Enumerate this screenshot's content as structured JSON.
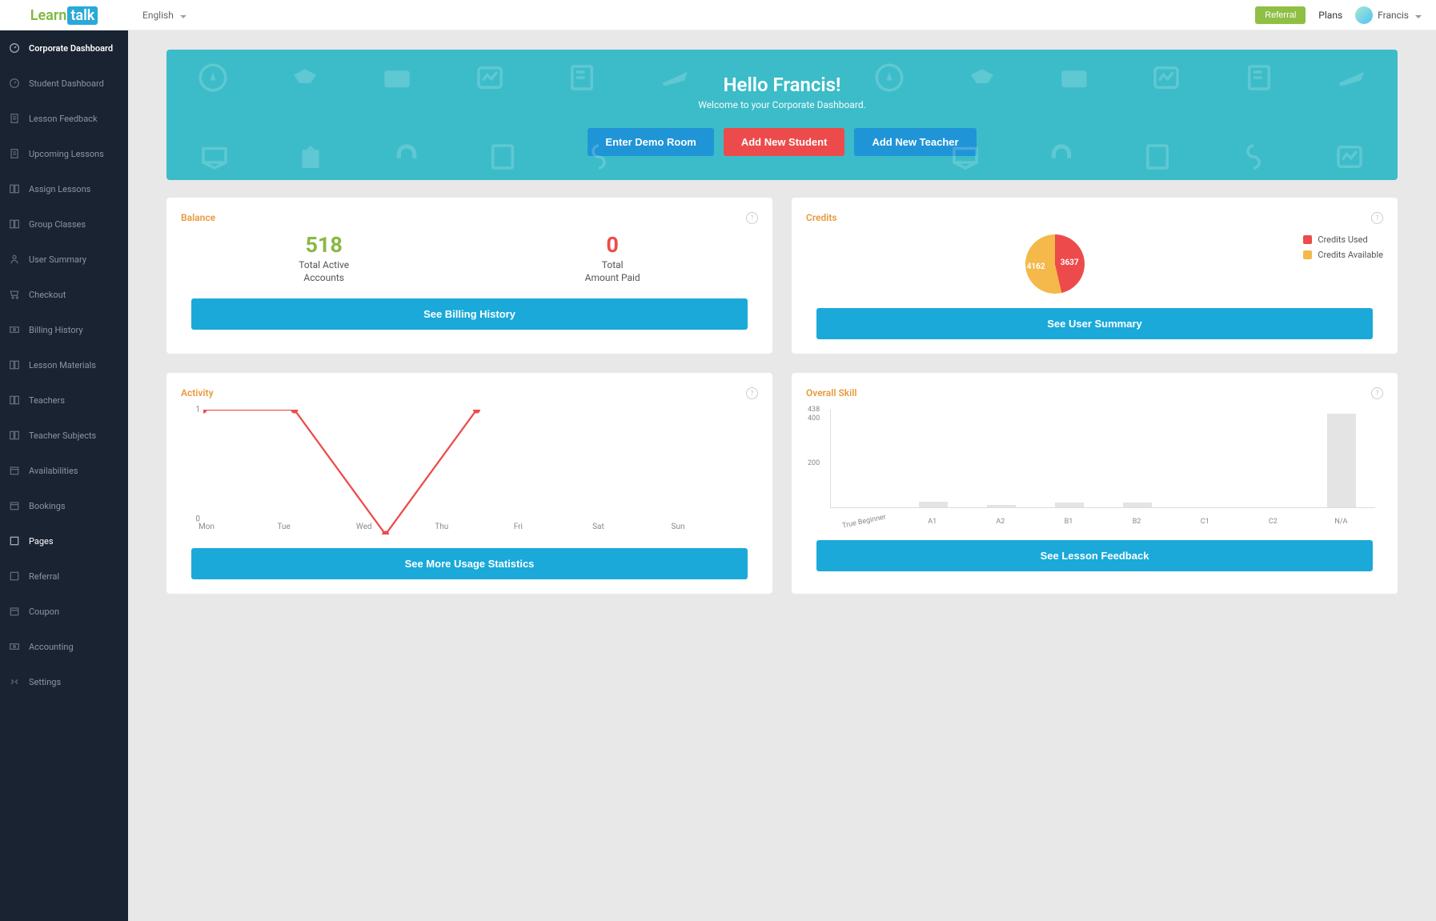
{
  "brand": {
    "learn": "Learn",
    "talk": "talk"
  },
  "topbar": {
    "lang": "English",
    "referral": "Referral",
    "plans": "Plans",
    "user": "Francis"
  },
  "sidebar": {
    "items": [
      {
        "label": "Corporate Dashboard",
        "icon": "dashboard-icon",
        "active": true
      },
      {
        "label": "Student Dashboard",
        "icon": "dashboard-icon"
      },
      {
        "label": "Lesson Feedback",
        "icon": "document-icon"
      },
      {
        "label": "Upcoming Lessons",
        "icon": "document-icon"
      },
      {
        "label": "Assign Lessons",
        "icon": "book-icon"
      },
      {
        "label": "Group Classes",
        "icon": "book-icon"
      },
      {
        "label": "User Summary",
        "icon": "user-icon"
      },
      {
        "label": "Checkout",
        "icon": "cart-icon"
      },
      {
        "label": "Billing History",
        "icon": "money-icon"
      },
      {
        "label": "Lesson Materials",
        "icon": "book-icon"
      },
      {
        "label": "Teachers",
        "icon": "book-icon"
      },
      {
        "label": "Teacher Subjects",
        "icon": "book-icon"
      },
      {
        "label": "Availabilities",
        "icon": "calendar-icon"
      },
      {
        "label": "Bookings",
        "icon": "calendar-icon"
      },
      {
        "label": "Pages",
        "icon": "page-icon",
        "active2": true
      },
      {
        "label": "Referral",
        "icon": "page-icon"
      },
      {
        "label": "Coupon",
        "icon": "calendar-icon"
      },
      {
        "label": "Accounting",
        "icon": "money-icon"
      },
      {
        "label": "Settings",
        "icon": "settings-icon"
      }
    ]
  },
  "hero": {
    "title": "Hello Francis!",
    "subtitle": "Welcome to your Corporate Dashboard.",
    "btn_demo": "Enter Demo Room",
    "btn_student": "Add New Student",
    "btn_teacher": "Add New Teacher"
  },
  "balance": {
    "title": "Balance",
    "active_val": "518",
    "active_label1": "Total Active",
    "active_label2": "Accounts",
    "paid_val": "0",
    "paid_label1": "Total",
    "paid_label2": "Amount Paid",
    "btn": "See Billing History"
  },
  "credits": {
    "title": "Credits",
    "used": "3637",
    "available": "4162",
    "legend_used": "Credits Used",
    "legend_available": "Credits Available",
    "btn": "See User Summary",
    "colors": {
      "used": "#ed4b4b",
      "available": "#f4b94a"
    }
  },
  "activity": {
    "title": "Activity",
    "btn": "See More Usage Statistics"
  },
  "skill": {
    "title": "Overall Skill",
    "btn": "See Lesson Feedback"
  },
  "chart_data": [
    {
      "type": "pie",
      "title": "Credits",
      "series": [
        {
          "name": "Credits Used",
          "value": 3637
        },
        {
          "name": "Credits Available",
          "value": 4162
        }
      ]
    },
    {
      "type": "line",
      "title": "Activity",
      "categories": [
        "Mon",
        "Tue",
        "Wed",
        "Thu",
        "Fri",
        "Sat",
        "Sun"
      ],
      "values": [
        1,
        1,
        0,
        1,
        null,
        null,
        null
      ],
      "ylim": [
        0,
        1
      ]
    },
    {
      "type": "bar",
      "title": "Overall Skill",
      "categories": [
        "True Beginner",
        "A1",
        "A2",
        "B1",
        "B2",
        "C1",
        "C2",
        "N/A"
      ],
      "values": [
        0,
        25,
        12,
        22,
        22,
        0,
        0,
        420
      ],
      "ylim": [
        0,
        438
      ],
      "yticks": [
        200,
        400,
        438
      ]
    }
  ]
}
